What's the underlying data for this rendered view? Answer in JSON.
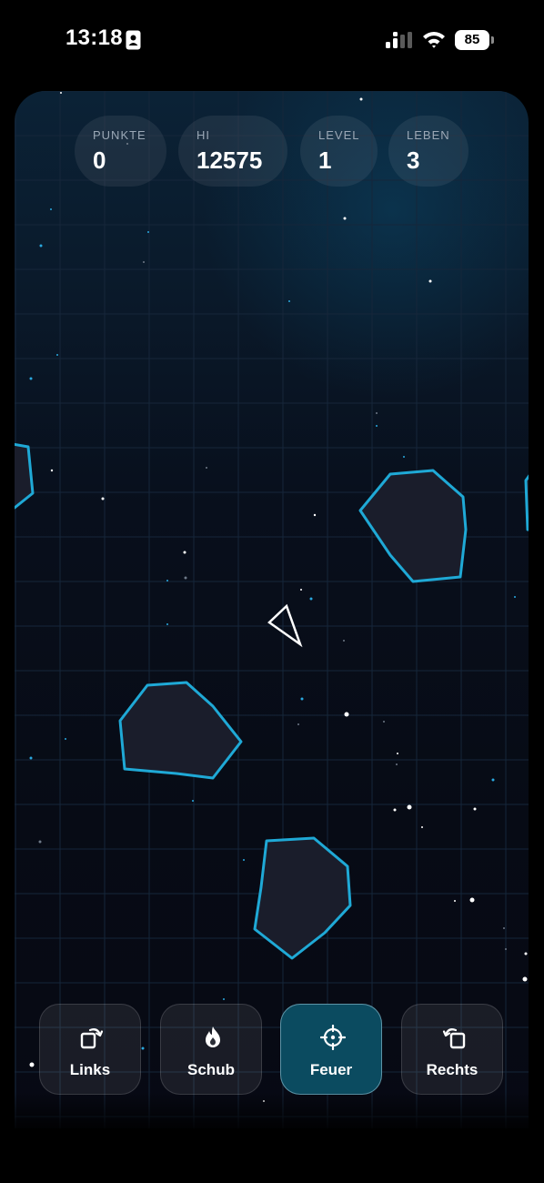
{
  "status_bar": {
    "time": "13:18",
    "battery": "85"
  },
  "hud": {
    "score_label": "PUNKTE",
    "score_value": "0",
    "hi_label": "HI",
    "hi_value": "12575",
    "level_label": "LEVEL",
    "level_value": "1",
    "lives_label": "LEBEN",
    "lives_value": "3"
  },
  "controls": {
    "left_label": "Links",
    "thrust_label": "Schub",
    "fire_label": "Feuer",
    "right_label": "Rechts"
  },
  "colors": {
    "asteroid_outline": "#1fa9d6",
    "asteroid_fill": "#1a1d2b",
    "ship_outline": "#ffffff",
    "grid_line": "#16263a",
    "accent_star": "#2aa9e0",
    "fire_button_active": "#0b4b60"
  },
  "icons": {
    "left": "rotate-left-icon",
    "thrust": "flame-icon",
    "fire": "crosshair-icon",
    "right": "rotate-right-icon"
  }
}
